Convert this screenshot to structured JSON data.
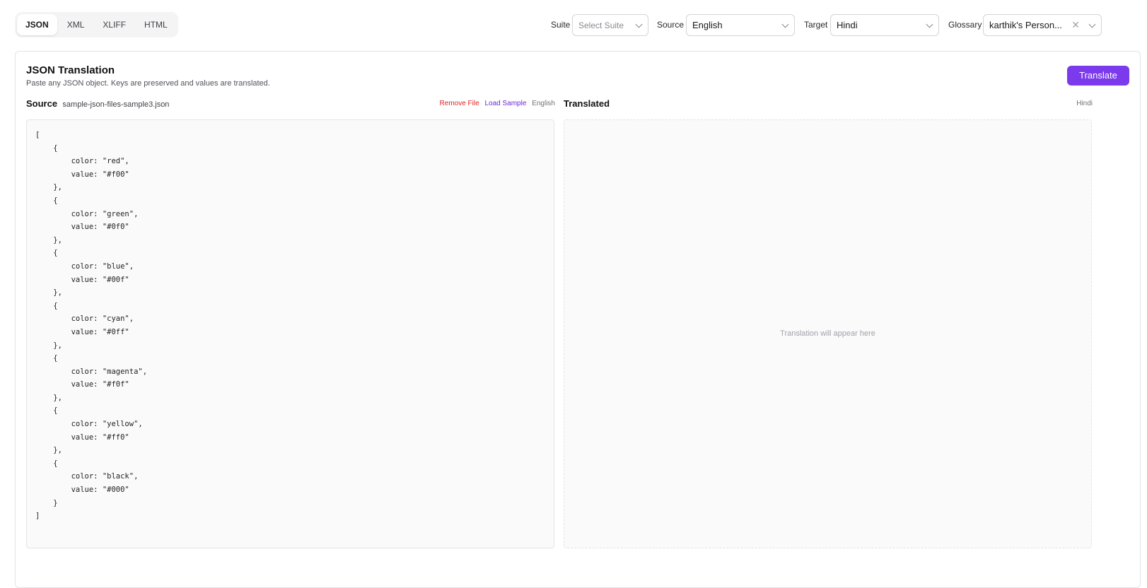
{
  "formats": {
    "tabs": [
      {
        "label": "JSON",
        "active": true
      },
      {
        "label": "XML",
        "active": false
      },
      {
        "label": "XLIFF",
        "active": false
      },
      {
        "label": "HTML",
        "active": false
      }
    ]
  },
  "controls": {
    "suite": {
      "label": "Suite",
      "placeholder": "Select Suite"
    },
    "source": {
      "label": "Source",
      "value": "English"
    },
    "target": {
      "label": "Target",
      "value": "Hindi"
    },
    "glossary": {
      "label": "Glossary",
      "value": "karthik's Person..."
    }
  },
  "card": {
    "title": "JSON Translation",
    "subtitle": "Paste any JSON object. Keys are preserved and values are translated.",
    "translate_label": "Translate"
  },
  "source_pane": {
    "title": "Source",
    "file_name": "sample-json-files-sample3.json",
    "remove_label": "Remove File",
    "load_label": "Load Sample",
    "language": "English",
    "content": "[\n    {\n        color: \"red\",\n        value: \"#f00\"\n    },\n    {\n        color: \"green\",\n        value: \"#0f0\"\n    },\n    {\n        color: \"blue\",\n        value: \"#00f\"\n    },\n    {\n        color: \"cyan\",\n        value: \"#0ff\"\n    },\n    {\n        color: \"magenta\",\n        value: \"#f0f\"\n    },\n    {\n        color: \"yellow\",\n        value: \"#ff0\"\n    },\n    {\n        color: \"black\",\n        value: \"#000\"\n    }\n]"
  },
  "translated_pane": {
    "title": "Translated",
    "language": "Hindi",
    "placeholder": "Translation will appear here"
  },
  "colors": {
    "accent": "#7c3aed",
    "remove_link": "#dc2626",
    "load_link": "#6d28d9"
  }
}
